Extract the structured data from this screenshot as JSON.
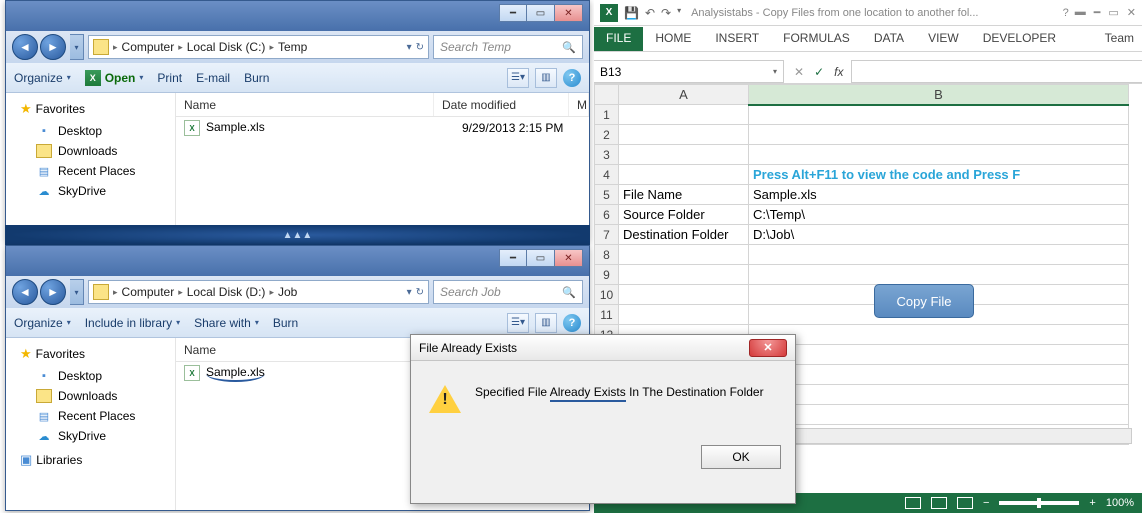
{
  "explorer1": {
    "breadcrumb": [
      "Computer",
      "Local Disk (C:)",
      "Temp"
    ],
    "search_placeholder": "Search Temp",
    "toolbar": {
      "organize": "Organize",
      "open": "Open",
      "print": "Print",
      "email": "E-mail",
      "burn": "Burn"
    },
    "columns": {
      "name": "Name",
      "date": "Date modified",
      "type": "M"
    },
    "file": {
      "name": "Sample.xls",
      "date": "9/29/2013 2:15 PM"
    },
    "favorites": "Favorites",
    "nav": {
      "desktop": "Desktop",
      "downloads": "Downloads",
      "recent": "Recent Places",
      "skydrive": "SkyDrive"
    }
  },
  "explorer2": {
    "breadcrumb": [
      "Computer",
      "Local Disk (D:)",
      "Job"
    ],
    "search_placeholder": "Search Job",
    "toolbar": {
      "organize": "Organize",
      "include": "Include in library",
      "share": "Share with",
      "burn": "Burn"
    },
    "columns": {
      "name": "Name"
    },
    "file": {
      "name": "Sample.xls"
    },
    "favorites": "Favorites",
    "libraries": "Libraries",
    "nav": {
      "desktop": "Desktop",
      "downloads": "Downloads",
      "recent": "Recent Places",
      "skydrive": "SkyDrive"
    }
  },
  "dialog": {
    "title": "File Already Exists",
    "message_pre": "Specified File ",
    "message_u": "Already Exists",
    "message_post": " In The Destination Folder",
    "ok": "OK"
  },
  "excel": {
    "title": "Analysistabs - Copy Files from one location to another fol...",
    "tabs": {
      "file": "FILE",
      "home": "HOME",
      "insert": "INSERT",
      "formulas": "FORMULAS",
      "data": "DATA",
      "view": "VIEW",
      "developer": "DEVELOPER",
      "team": "Team"
    },
    "namebox": "B13",
    "colA": "A",
    "colB": "B",
    "rows": {
      "r4": "Press Alt+F11 to view the code and Press F",
      "r5a": "File Name",
      "r5b": "Sample.xls",
      "r6a": "Source Folder",
      "r6b": "C:\\Temp\\",
      "r7a": "Destination Folder",
      "r7b": "D:\\Job\\"
    },
    "button": "Copy File",
    "zoom": "100%"
  }
}
